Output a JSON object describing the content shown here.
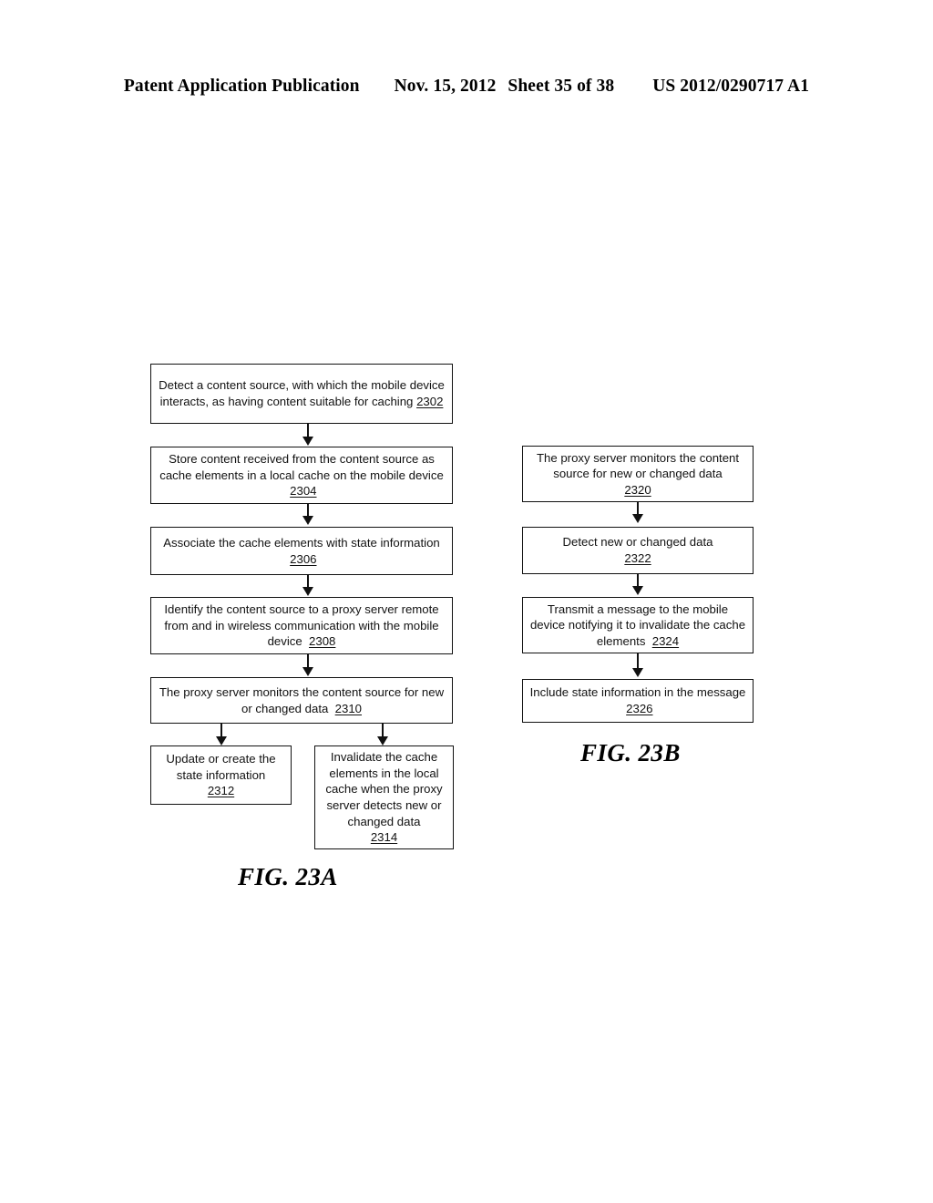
{
  "header": {
    "publication": "Patent Application Publication",
    "date": "Nov. 15, 2012",
    "sheet": "Sheet 35 of 38",
    "patent_number": "US 2012/0290717 A1"
  },
  "figures": [
    {
      "caption": "FIG. 23A",
      "boxes": [
        {
          "id": "2302",
          "text": "Detect a content source, with which the mobile device interacts, as having content suitable for caching",
          "ref": "2302"
        },
        {
          "id": "2304",
          "text": "Store content received from the content source as cache elements in a local cache on the mobile device",
          "ref": "2304"
        },
        {
          "id": "2306",
          "text": "Associate the cache elements with state information",
          "ref": "2306"
        },
        {
          "id": "2308",
          "text": "Identify the content source to a proxy server remote from and in wireless communication with the mobile device",
          "ref": "2308"
        },
        {
          "id": "2310",
          "text": "The proxy server monitors the content source for new or changed data",
          "ref": "2310"
        },
        {
          "id": "2312",
          "text": "Update or create the state information",
          "ref": "2312"
        },
        {
          "id": "2314",
          "text": "Invalidate the cache elements in the local cache when the proxy server detects new or changed data",
          "ref": "2314"
        }
      ]
    },
    {
      "caption": "FIG. 23B",
      "boxes": [
        {
          "id": "2320",
          "text": "The proxy server monitors the content source for new or changed data",
          "ref": "2320"
        },
        {
          "id": "2322",
          "text": "Detect new or changed data",
          "ref": "2322"
        },
        {
          "id": "2324",
          "text": "Transmit a message to the mobile device notifying it to invalidate the cache elements",
          "ref": "2324"
        },
        {
          "id": "2326",
          "text": "Include state information in the message",
          "ref": "2326"
        }
      ]
    }
  ]
}
